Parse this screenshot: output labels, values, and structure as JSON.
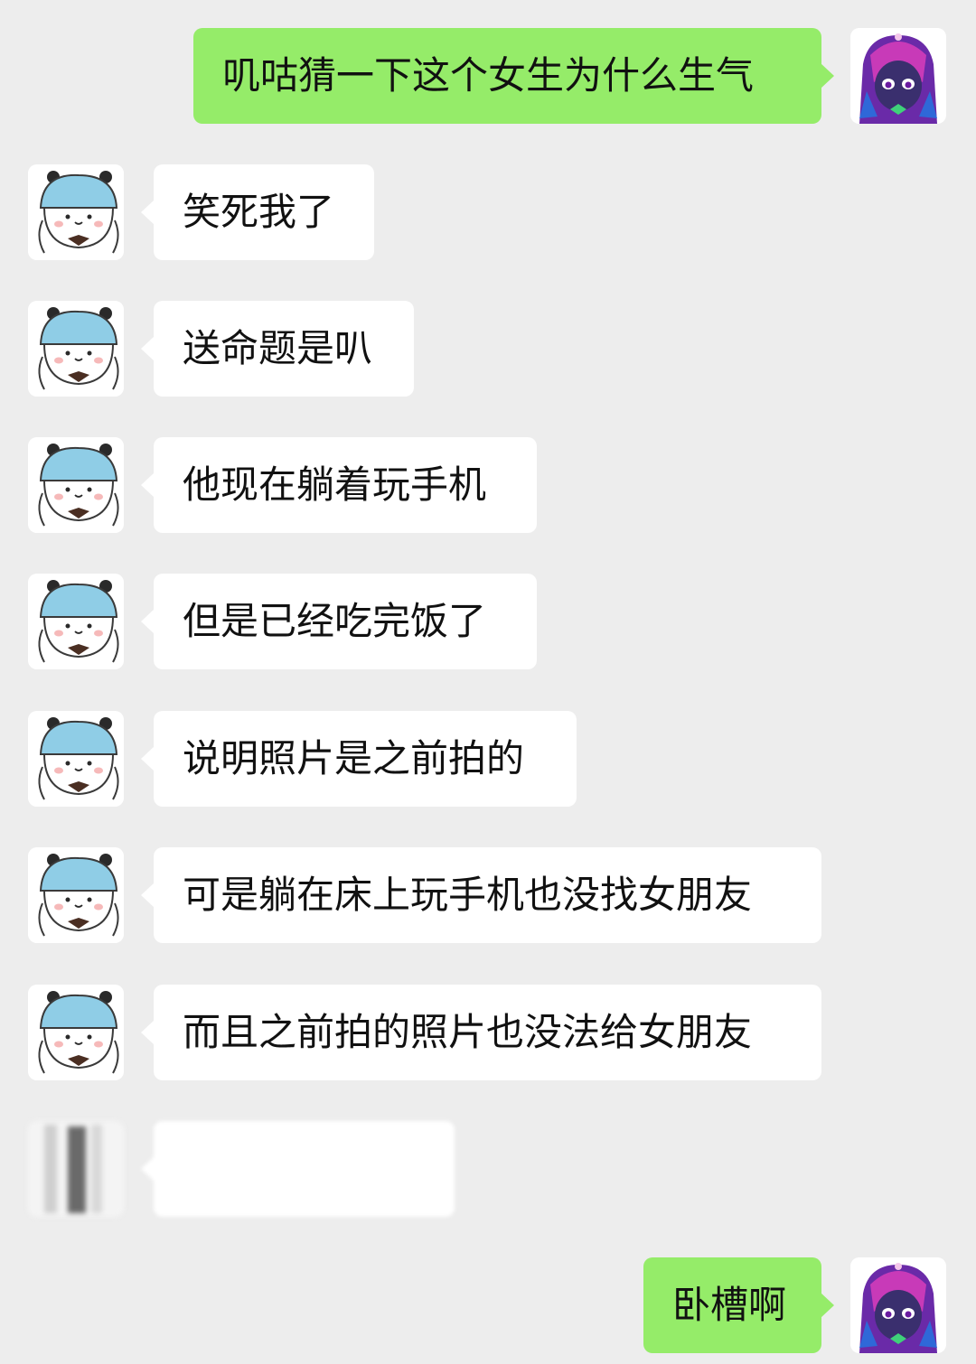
{
  "messages": [
    {
      "side": "out",
      "text": "叽咕猜一下这个女生为什么生气",
      "avatar": "purple-anime-avatar-icon"
    },
    {
      "side": "in",
      "text": "笑死我了",
      "avatar": "blue-hat-bear-avatar-icon"
    },
    {
      "side": "in",
      "text": "送命题是叭",
      "avatar": "blue-hat-bear-avatar-icon"
    },
    {
      "side": "in",
      "text": "他现在躺着玩手机",
      "avatar": "blue-hat-bear-avatar-icon"
    },
    {
      "side": "in",
      "text": "但是已经吃完饭了",
      "avatar": "blue-hat-bear-avatar-icon"
    },
    {
      "side": "in",
      "text": "说明照片是之前拍的",
      "avatar": "blue-hat-bear-avatar-icon"
    },
    {
      "side": "in",
      "text": "可是躺在床上玩手机也没找女朋友",
      "avatar": "blue-hat-bear-avatar-icon"
    },
    {
      "side": "in",
      "text": "而且之前拍的照片也没法给女朋友",
      "avatar": "blue-hat-bear-avatar-icon"
    },
    {
      "side": "in",
      "text": "",
      "avatar": "blurred-avatar-icon",
      "blurred": true
    },
    {
      "side": "out",
      "text": "卧槽啊",
      "avatar": "purple-anime-avatar-icon"
    }
  ],
  "colors": {
    "background": "#ededed",
    "incoming_bubble": "#ffffff",
    "outgoing_bubble": "#95ec69",
    "text": "#111111"
  }
}
